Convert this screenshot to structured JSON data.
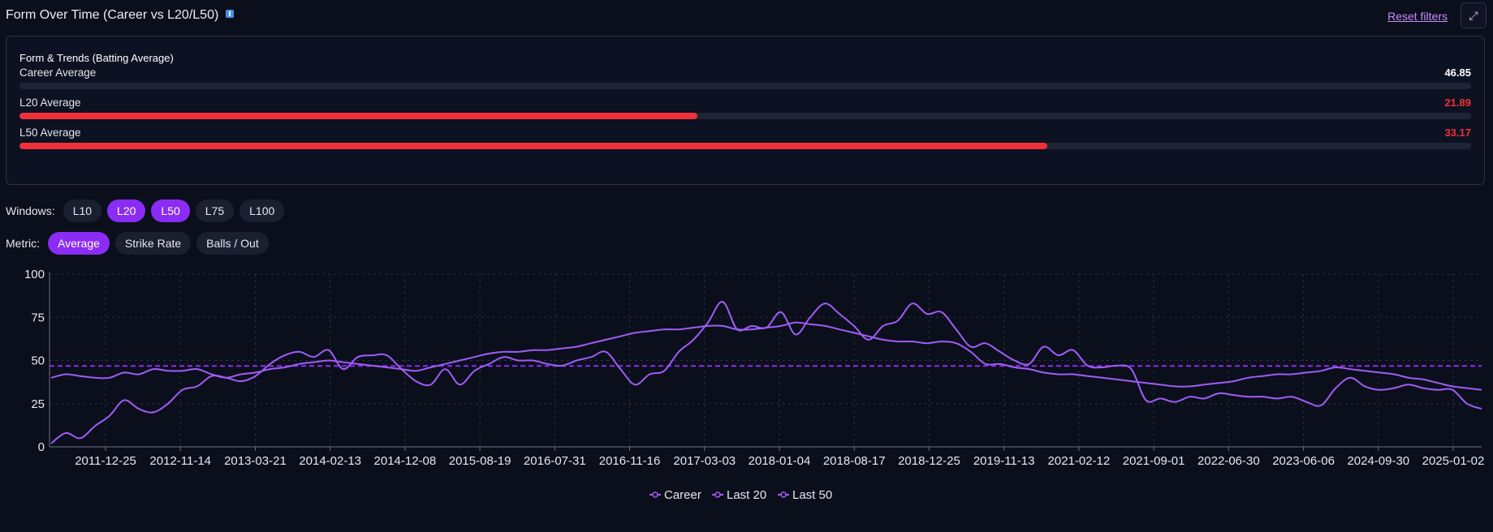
{
  "header": {
    "title": "Form Over Time (Career vs L20/L50)",
    "reset_label": "Reset filters",
    "expand_icon": "⤢"
  },
  "form_card": {
    "title": "Form & Trends (Batting Average)",
    "metrics": [
      {
        "label": "Career Average",
        "value": "46.85",
        "fill_fraction": 0,
        "value_color": "#ffffff"
      },
      {
        "label": "L20 Average",
        "value": "21.89",
        "fill_fraction": 0.467,
        "value_color": "#f0303a"
      },
      {
        "label": "L50 Average",
        "value": "33.17",
        "fill_fraction": 0.708,
        "value_color": "#f0303a"
      }
    ]
  },
  "windows": {
    "label": "Windows:",
    "options": [
      {
        "label": "L10",
        "active": false
      },
      {
        "label": "L20",
        "active": true
      },
      {
        "label": "L50",
        "active": true
      },
      {
        "label": "L75",
        "active": false
      },
      {
        "label": "L100",
        "active": false
      }
    ]
  },
  "metric": {
    "label": "Metric:",
    "options": [
      {
        "label": "Average",
        "active": true
      },
      {
        "label": "Strike Rate",
        "active": false
      },
      {
        "label": "Balls / Out",
        "active": false
      }
    ]
  },
  "colors": {
    "accent": "#8b2cf5",
    "line": "#a15cf7",
    "reference": "#8b2cf5",
    "bar_fill": "#f0303a",
    "grid": "#2a3042"
  },
  "chart_data": {
    "type": "line",
    "ylim": [
      0,
      100
    ],
    "yticks": [
      0,
      25,
      50,
      75,
      100
    ],
    "xticks": [
      "2011-12-25",
      "2012-11-14",
      "2013-03-21",
      "2014-02-13",
      "2014-12-08",
      "2015-08-19",
      "2016-07-31",
      "2016-11-16",
      "2017-03-03",
      "2018-01-04",
      "2018-08-17",
      "2018-12-25",
      "2019-11-13",
      "2021-02-12",
      "2021-09-01",
      "2022-06-30",
      "2023-06-06",
      "2024-09-30",
      "2025-01-02"
    ],
    "reference_line": {
      "value": 46.85,
      "style": "dashed"
    },
    "legend": [
      "Career",
      "Last 20",
      "Last 50"
    ],
    "series": [
      {
        "name": "Last 20",
        "values": [
          2,
          8,
          5,
          12,
          18,
          27,
          22,
          20,
          25,
          33,
          35,
          41,
          40,
          38,
          41,
          48,
          53,
          55,
          52,
          56,
          45,
          52,
          53,
          53,
          45,
          38,
          36,
          45,
          36,
          44,
          48,
          52,
          50,
          50,
          48,
          47,
          50,
          52,
          55,
          45,
          36,
          42,
          44,
          55,
          62,
          72,
          84,
          68,
          70,
          69,
          78,
          65,
          75,
          83,
          77,
          70,
          62,
          70,
          73,
          83,
          77,
          78,
          68,
          58,
          60,
          55,
          50,
          48,
          58,
          53,
          56,
          47,
          46,
          47,
          45,
          27,
          28,
          26,
          29,
          28,
          31,
          30,
          29,
          29,
          28,
          29,
          26,
          24,
          34,
          40,
          35,
          33,
          34,
          36,
          34,
          33,
          33,
          25,
          22
        ]
      },
      {
        "name": "Last 50",
        "values": [
          40,
          42,
          41,
          40,
          40,
          43,
          42,
          45,
          44,
          44,
          45,
          42,
          40,
          42,
          43,
          45,
          46,
          48,
          49,
          50,
          49,
          48,
          47,
          46,
          45,
          44,
          46,
          48,
          50,
          52,
          54,
          55,
          55,
          56,
          56,
          57,
          58,
          60,
          62,
          64,
          66,
          67,
          68,
          68,
          69,
          70,
          70,
          68,
          68,
          69,
          70,
          72,
          71,
          70,
          68,
          66,
          64,
          62,
          61,
          61,
          60,
          61,
          60,
          55,
          48,
          48,
          46,
          45,
          43,
          42,
          42,
          41,
          40,
          39,
          38,
          37,
          36,
          35,
          35,
          36,
          37,
          38,
          40,
          41,
          42,
          42,
          43,
          44,
          46,
          45,
          44,
          43,
          42,
          40,
          39,
          37,
          35,
          34,
          33
        ]
      },
      {
        "name": "Career",
        "values": [
          46,
          46,
          46,
          46,
          46,
          46,
          46,
          46,
          46,
          46,
          46,
          46,
          46,
          46,
          46,
          46,
          46,
          46,
          46,
          46,
          46,
          46,
          46,
          46,
          46,
          46,
          46,
          46,
          46,
          46,
          46,
          46,
          46,
          46,
          46,
          46,
          46,
          46,
          46,
          46,
          46,
          46,
          46,
          46,
          46,
          46,
          46,
          46,
          46,
          46,
          46,
          46,
          46,
          46,
          46,
          46,
          46,
          46,
          46,
          46,
          46,
          46,
          46,
          46,
          46,
          46,
          46,
          46,
          46,
          46,
          46,
          46,
          46,
          46,
          46,
          46,
          46,
          46,
          46,
          46,
          46,
          46,
          46,
          46,
          46,
          46,
          46,
          46,
          46,
          46,
          46,
          46,
          46,
          46,
          46,
          46,
          46,
          46,
          46
        ]
      }
    ]
  }
}
